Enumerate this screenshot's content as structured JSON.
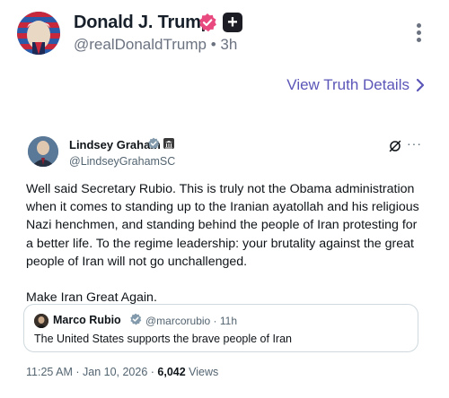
{
  "post": {
    "author_name": "Donald J. Trump",
    "handle": "@realDonaldTrump",
    "separator": "•",
    "time": "3h",
    "details_link": "View Truth Details",
    "verified_color": "#e84a7f",
    "accent_color": "#5b56b8"
  },
  "card": {
    "author_name": "Lindsey Graham",
    "handle": "@LindseyGrahamSC",
    "more": "···",
    "body_paragraph_1": "Well said Secretary Rubio. This is truly not the Obama administration when it comes to standing up to the Iranian ayatollah and his religious Nazi henchmen, and standing behind the people of Iran protesting for a better life. To the regime leadership: your brutality against the great people of Iran will not go unchallenged.",
    "body_paragraph_2": "Make Iran Great Again.",
    "quote": {
      "author_name": "Marco Rubio",
      "handle": "@marcorubio · 11h",
      "text": "The United States supports the brave people of Iran"
    },
    "timestamp": "11:25 AM · Jan 10, 2026 · ",
    "views_count": "6,042",
    "views_label": " Views"
  },
  "icons": {
    "verified": "verified-check-icon",
    "plus": "plus-badge-icon",
    "more": "more-vertical-icon",
    "chevron": "chevron-right-icon",
    "grok": "grok-icon",
    "government": "government-badge-icon"
  }
}
